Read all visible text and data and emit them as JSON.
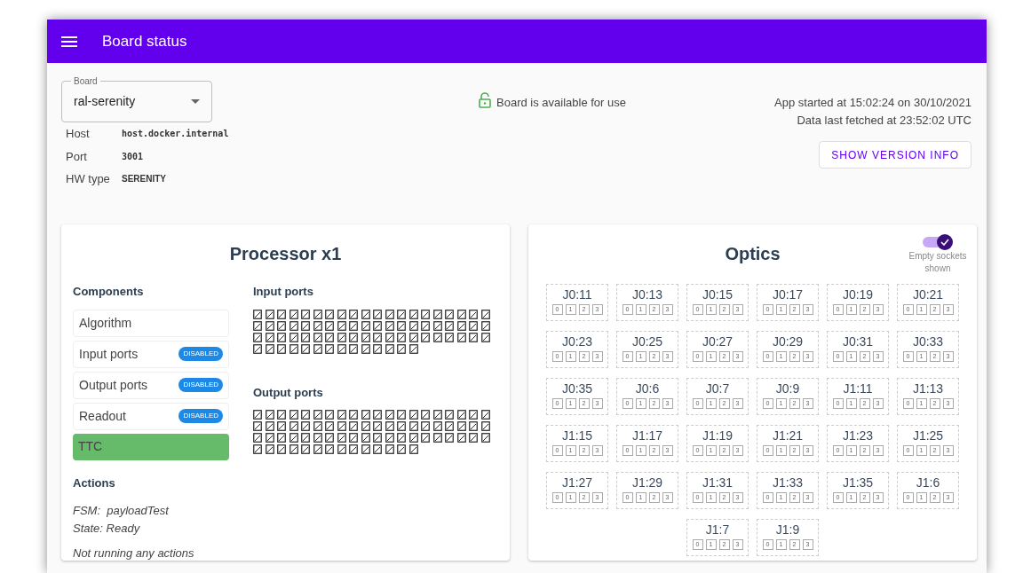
{
  "app_bar": {
    "title": "Board status"
  },
  "board_select": {
    "label": "Board",
    "value": "ral-serenity"
  },
  "board_info": [
    {
      "label": "Host",
      "value": "host.docker.internal",
      "kind": "mono"
    },
    {
      "label": "Port",
      "value": "3001",
      "kind": "mono"
    },
    {
      "label": "HW type",
      "value": "SERENITY",
      "kind": "caps"
    }
  ],
  "availability": {
    "text": "Board is available for use",
    "locked": false
  },
  "app_info": {
    "started": "App started at 15:02:24 on 30/10/2021",
    "fetched": "Data last fetched at 23:52:02 UTC",
    "button": "SHOW VERSION INFO"
  },
  "processor": {
    "title": "Processor x1",
    "components_heading": "Components",
    "components": [
      {
        "label": "Algorithm",
        "highlighted": false
      },
      {
        "label": "Input ports",
        "badge": "DISABLED",
        "highlighted": false
      },
      {
        "label": "Output ports",
        "badge": "DISABLED",
        "highlighted": false
      },
      {
        "label": "Readout",
        "badge": "DISABLED",
        "highlighted": false
      },
      {
        "label": "TTC",
        "highlighted": true
      }
    ],
    "actions_heading": "Actions",
    "fsm": "FSM:  payloadTest",
    "state": "State: Ready",
    "running": "Not running any actions",
    "port_groups": [
      {
        "title": "Input ports",
        "ports": [
          {
            "kind": "unknown"
          },
          {
            "kind": "unknown"
          },
          {
            "kind": "unknown"
          },
          {
            "kind": "unknown"
          },
          {
            "kind": "unknown"
          },
          {
            "kind": "unknown"
          },
          {
            "kind": "unknown"
          },
          {
            "kind": "unknown"
          },
          {
            "kind": "unknown"
          },
          {
            "kind": "unknown"
          },
          {
            "kind": "unknown"
          },
          {
            "kind": "unknown"
          },
          {
            "kind": "unknown"
          },
          {
            "kind": "unknown"
          },
          {
            "kind": "unknown"
          },
          {
            "kind": "unknown"
          },
          {
            "kind": "unknown"
          },
          {
            "kind": "unknown"
          },
          {
            "kind": "unknown"
          },
          {
            "kind": "unknown"
          },
          {
            "kind": "unknown"
          },
          {
            "kind": "unknown"
          },
          {
            "kind": "unknown"
          },
          {
            "kind": "unknown"
          },
          {
            "kind": "unknown"
          },
          {
            "kind": "unknown"
          },
          {
            "kind": "unknown"
          },
          {
            "kind": "unknown"
          },
          {
            "kind": "unknown"
          },
          {
            "kind": "unknown"
          },
          {
            "kind": "unknown"
          },
          {
            "kind": "unknown"
          },
          {
            "kind": "unknown"
          },
          {
            "kind": "unknown"
          },
          {
            "kind": "unknown"
          },
          {
            "kind": "unknown"
          },
          {
            "kind": "unknown"
          },
          {
            "kind": "unknown"
          },
          {
            "kind": "unknown"
          },
          {
            "kind": "unknown"
          },
          {
            "kind": "unknown"
          },
          {
            "kind": "unknown"
          },
          {
            "kind": "unknown"
          },
          {
            "kind": "unknown"
          },
          {
            "kind": "unknown"
          },
          {
            "kind": "unknown"
          },
          {
            "kind": "unknown"
          },
          {
            "kind": "unknown"
          },
          {
            "kind": "unknown"
          },
          {
            "kind": "unknown"
          },
          {
            "kind": "unknown"
          },
          {
            "kind": "unknown"
          },
          {
            "kind": "unknown"
          },
          {
            "kind": "unknown"
          },
          {
            "kind": "unknown"
          },
          {
            "kind": "unknown"
          },
          {
            "kind": "unknown"
          },
          {
            "kind": "unknown"
          },
          {
            "kind": "unknown"
          },
          {
            "kind": "unknown"
          },
          {
            "kind": "unknown"
          },
          {
            "kind": "unknown"
          },
          {
            "kind": "unknown"
          },
          {
            "kind": "unknown"
          },
          {
            "kind": "unknown"
          },
          {
            "kind": "unknown"
          },
          {
            "kind": "unknown"
          },
          {
            "kind": "unknown"
          },
          {
            "kind": "unknown"
          },
          {
            "kind": "unknown"
          },
          {
            "kind": "unknown"
          },
          {
            "kind": "unknown"
          },
          {
            "kind": "unknown"
          },
          {
            "kind": "unknown"
          }
        ]
      },
      {
        "title": "Output ports",
        "ports": [
          {
            "kind": "unknown"
          },
          {
            "kind": "unknown"
          },
          {
            "kind": "unknown"
          },
          {
            "kind": "unknown"
          },
          {
            "kind": "unknown"
          },
          {
            "kind": "unknown"
          },
          {
            "kind": "unknown"
          },
          {
            "kind": "unknown"
          },
          {
            "kind": "unknown"
          },
          {
            "kind": "unknown"
          },
          {
            "kind": "unknown"
          },
          {
            "kind": "unknown"
          },
          {
            "kind": "unknown"
          },
          {
            "kind": "unknown"
          },
          {
            "kind": "unknown"
          },
          {
            "kind": "unknown"
          },
          {
            "kind": "unknown"
          },
          {
            "kind": "unknown"
          },
          {
            "kind": "unknown"
          },
          {
            "kind": "unknown"
          },
          {
            "kind": "unknown"
          },
          {
            "kind": "unknown"
          },
          {
            "kind": "unknown"
          },
          {
            "kind": "unknown"
          },
          {
            "kind": "unknown"
          },
          {
            "kind": "unknown"
          },
          {
            "kind": "unknown"
          },
          {
            "kind": "unknown"
          },
          {
            "kind": "unknown"
          },
          {
            "kind": "unknown"
          },
          {
            "kind": "unknown"
          },
          {
            "kind": "unknown"
          },
          {
            "kind": "unknown"
          },
          {
            "kind": "unknown"
          },
          {
            "kind": "unknown"
          },
          {
            "kind": "unknown"
          },
          {
            "kind": "unknown"
          },
          {
            "kind": "unknown"
          },
          {
            "kind": "unknown"
          },
          {
            "kind": "unknown"
          },
          {
            "kind": "unknown"
          },
          {
            "kind": "unknown"
          },
          {
            "kind": "unknown"
          },
          {
            "kind": "unknown"
          },
          {
            "kind": "unknown"
          },
          {
            "kind": "unknown"
          },
          {
            "kind": "unknown"
          },
          {
            "kind": "unknown"
          },
          {
            "kind": "unknown"
          },
          {
            "kind": "unknown"
          },
          {
            "kind": "unknown"
          },
          {
            "kind": "unknown"
          },
          {
            "kind": "unknown"
          },
          {
            "kind": "unknown"
          },
          {
            "kind": "unknown"
          },
          {
            "kind": "unknown"
          },
          {
            "kind": "unknown"
          },
          {
            "kind": "unknown"
          },
          {
            "kind": "unknown"
          },
          {
            "kind": "unknown"
          },
          {
            "kind": "unknown"
          },
          {
            "kind": "unknown"
          },
          {
            "kind": "unknown"
          },
          {
            "kind": "unknown"
          },
          {
            "kind": "unknown"
          },
          {
            "kind": "unknown"
          },
          {
            "kind": "unknown"
          },
          {
            "kind": "unknown"
          },
          {
            "kind": "unknown"
          },
          {
            "kind": "unknown"
          },
          {
            "kind": "unknown"
          },
          {
            "kind": "unknown"
          },
          {
            "kind": "unknown"
          },
          {
            "kind": "unknown"
          }
        ]
      }
    ]
  },
  "optics": {
    "title": "Optics",
    "toggle": {
      "label": "Empty sockets shown",
      "on": true
    },
    "sockets": [
      {
        "label": "J0:11",
        "channels": [
          "0",
          "1",
          "2",
          "3"
        ]
      },
      {
        "label": "J0:13",
        "channels": [
          "0",
          "1",
          "2",
          "3"
        ]
      },
      {
        "label": "J0:15",
        "channels": [
          "0",
          "1",
          "2",
          "3"
        ]
      },
      {
        "label": "J0:17",
        "channels": [
          "0",
          "1",
          "2",
          "3"
        ]
      },
      {
        "label": "J0:19",
        "channels": [
          "0",
          "1",
          "2",
          "3"
        ]
      },
      {
        "label": "J0:21",
        "channels": [
          "0",
          "1",
          "2",
          "3"
        ]
      },
      {
        "label": "J0:23",
        "channels": [
          "0",
          "1",
          "2",
          "3"
        ]
      },
      {
        "label": "J0:25",
        "channels": [
          "0",
          "1",
          "2",
          "3"
        ]
      },
      {
        "label": "J0:27",
        "channels": [
          "0",
          "1",
          "2",
          "3"
        ]
      },
      {
        "label": "J0:29",
        "channels": [
          "0",
          "1",
          "2",
          "3"
        ]
      },
      {
        "label": "J0:31",
        "channels": [
          "0",
          "1",
          "2",
          "3"
        ]
      },
      {
        "label": "J0:33",
        "channels": [
          "0",
          "1",
          "2",
          "3"
        ]
      },
      {
        "label": "J0:35",
        "channels": [
          "0",
          "1",
          "2",
          "3"
        ]
      },
      {
        "label": "J0:6",
        "channels": [
          "0",
          "1",
          "2",
          "3"
        ]
      },
      {
        "label": "J0:7",
        "channels": [
          "0",
          "1",
          "2",
          "3"
        ]
      },
      {
        "label": "J0:9",
        "channels": [
          "0",
          "1",
          "2",
          "3"
        ]
      },
      {
        "label": "J1:11",
        "channels": [
          "0",
          "1",
          "2",
          "3"
        ]
      },
      {
        "label": "J1:13",
        "channels": [
          "0",
          "1",
          "2",
          "3"
        ]
      },
      {
        "label": "J1:15",
        "channels": [
          "0",
          "1",
          "2",
          "3"
        ]
      },
      {
        "label": "J1:17",
        "channels": [
          "0",
          "1",
          "2",
          "3"
        ]
      },
      {
        "label": "J1:19",
        "channels": [
          "0",
          "1",
          "2",
          "3"
        ]
      },
      {
        "label": "J1:21",
        "channels": [
          "0",
          "1",
          "2",
          "3"
        ]
      },
      {
        "label": "J1:23",
        "channels": [
          "0",
          "1",
          "2",
          "3"
        ]
      },
      {
        "label": "J1:25",
        "channels": [
          "0",
          "1",
          "2",
          "3"
        ]
      },
      {
        "label": "J1:27",
        "channels": [
          "0",
          "1",
          "2",
          "3"
        ]
      },
      {
        "label": "J1:29",
        "channels": [
          "0",
          "1",
          "2",
          "3"
        ]
      },
      {
        "label": "J1:31",
        "channels": [
          "0",
          "1",
          "2",
          "3"
        ]
      },
      {
        "label": "J1:33",
        "channels": [
          "0",
          "1",
          "2",
          "3"
        ]
      },
      {
        "label": "J1:35",
        "channels": [
          "0",
          "1",
          "2",
          "3"
        ]
      },
      {
        "label": "J1:6",
        "channels": [
          "0",
          "1",
          "2",
          "3"
        ]
      },
      {
        "label": "J1:7",
        "channels": [
          "0",
          "1",
          "2",
          "3"
        ]
      },
      {
        "label": "J1:9",
        "channels": [
          "0",
          "1",
          "2",
          "3"
        ]
      }
    ]
  }
}
